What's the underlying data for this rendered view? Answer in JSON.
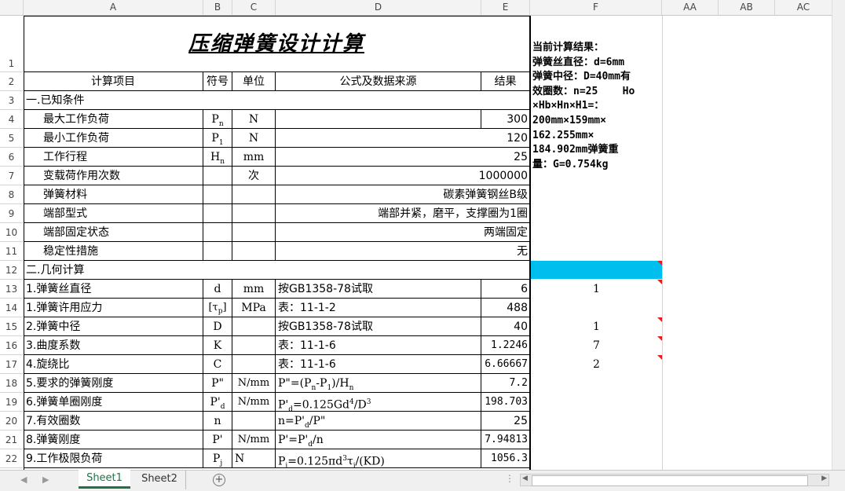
{
  "columns": [
    "A",
    "B",
    "C",
    "D",
    "E",
    "F",
    "AA",
    "AB",
    "AC"
  ],
  "rows": [
    "1",
    "2",
    "3",
    "4",
    "5",
    "6",
    "7",
    "8",
    "9",
    "10",
    "11",
    "12",
    "13",
    "14",
    "15",
    "16",
    "17",
    "18",
    "19",
    "20",
    "21",
    "22"
  ],
  "title": "压缩弹簧设计计算",
  "header": {
    "item": "计算项目",
    "symbol": "符号",
    "unit": "单位",
    "formula": "公式及数据来源",
    "result": "结果"
  },
  "section1": "一.已知条件",
  "section2": "二.几何计算",
  "known": [
    {
      "item": "最大工作负荷",
      "symbol": "Pn",
      "unit": "N",
      "value": "300"
    },
    {
      "item": "最小工作负荷",
      "symbol": "P1",
      "unit": "N",
      "value": "120"
    },
    {
      "item": "工作行程",
      "symbol": "Hn",
      "unit": "mm",
      "value": "25"
    },
    {
      "item": "变载荷作用次数",
      "symbol": "",
      "unit": "次",
      "value": "1000000"
    },
    {
      "item": "弹簧材料",
      "symbol": "",
      "unit": "",
      "value": "碳素弹簧钢丝B级"
    },
    {
      "item": "端部型式",
      "symbol": "",
      "unit": "",
      "value": "端部并紧，磨平，支撑圈为1圈"
    },
    {
      "item": "端部固定状态",
      "symbol": "",
      "unit": "",
      "value": "两端固定"
    },
    {
      "item": "稳定性措施",
      "symbol": "",
      "unit": "",
      "value": "无"
    }
  ],
  "calc": [
    {
      "item": "1.弹簧丝直径",
      "symbol": "d",
      "unit": "mm",
      "formula": "按GB1358-78试取",
      "value": "6",
      "f": "1"
    },
    {
      "item": "1.弹簧许用应力",
      "symbol": "[τp]",
      "unit": "MPa",
      "formula": "表：11-1-2",
      "value": "488",
      "f": ""
    },
    {
      "item": "2.弹簧中径",
      "symbol": "D",
      "unit": "",
      "formula": "按GB1358-78试取",
      "value": "40",
      "f": "1"
    },
    {
      "item": "3.曲度系数",
      "symbol": "K",
      "unit": "",
      "formula": "表：11-1-6",
      "value": "1.2246",
      "f": "7"
    },
    {
      "item": "4.旋绕比",
      "symbol": "C",
      "unit": "",
      "formula": "表：11-1-6",
      "value": "6.66667",
      "f": "2"
    },
    {
      "item": "5.要求的弹簧刚度",
      "symbol": "P\"",
      "unit": "N/mm",
      "formula": "P\"=(Pn-P1)/Hn",
      "value": "7.2",
      "f": ""
    },
    {
      "item": "6.弹簧单圈刚度",
      "symbol": "P'd",
      "unit": "N/mm",
      "formula": "P'd=0.125Gd⁴/D³",
      "value": "198.703",
      "f": ""
    },
    {
      "item": "7.有效圈数",
      "symbol": "n",
      "unit": "",
      "formula": "n=P'd/P\"",
      "value": "25",
      "f": ""
    },
    {
      "item": "8.弹簧刚度",
      "symbol": "P'",
      "unit": "N/mm",
      "formula": "P'=P'd/n",
      "value": "7.94813",
      "f": ""
    },
    {
      "item": "9.工作极限负荷",
      "symbol": "Pj",
      "unit": "N",
      "formula": "Pj=0.125πd³τj/(KD)",
      "value": "1056.3",
      "f": ""
    }
  ],
  "result_lines": [
    "当前计算结果：",
    "弹簧丝直径：d=6mm",
    "弹簧中径：D=40mm有",
    "效圈数：n=25    Ho",
    "×Hb×Hn×H1=：",
    "200mm×159mm×",
    "162.255mm×",
    "184.902mm弹簧重",
    "量：G=0.754kg"
  ],
  "highlight_color": "#00bfef",
  "tabs": [
    "Sheet1",
    "Sheet2"
  ],
  "active_tab": "Sheet1",
  "accent": "#217346"
}
